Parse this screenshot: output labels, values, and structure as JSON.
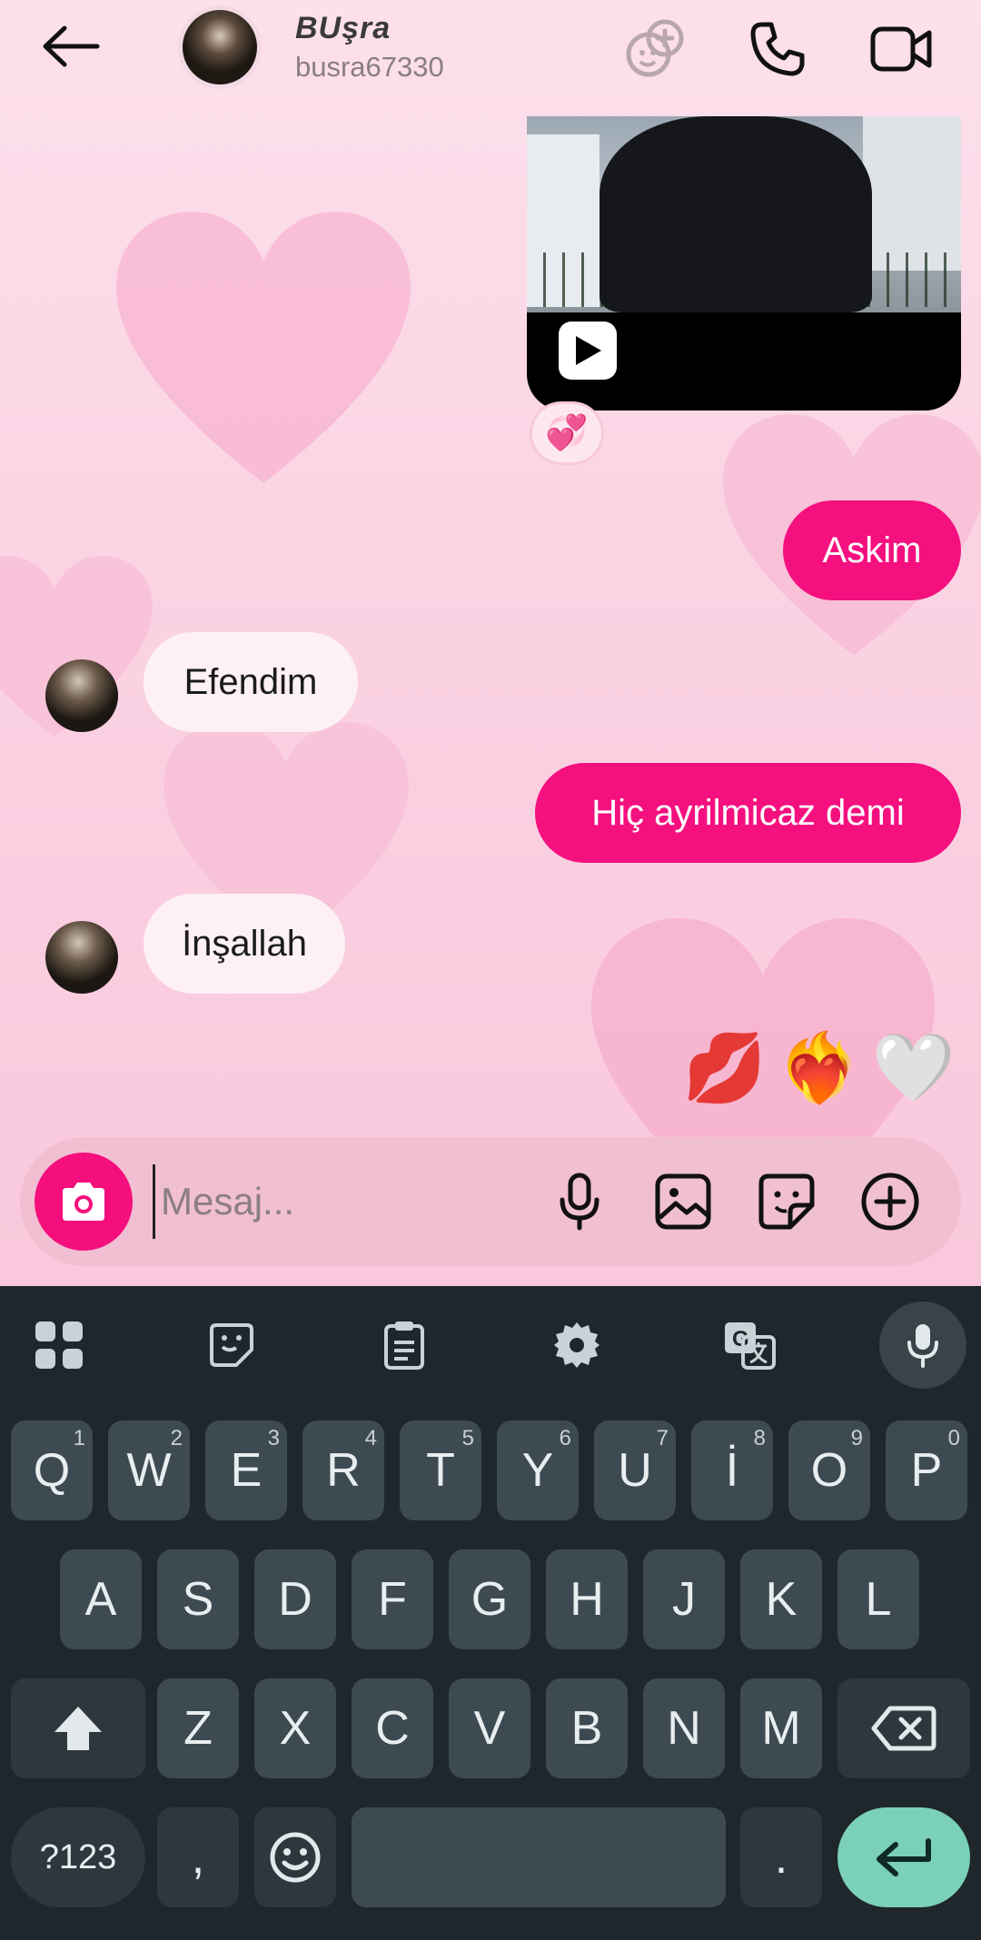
{
  "header": {
    "contact_name": "BUşra",
    "contact_handle": "busra67330"
  },
  "messages": [
    {
      "id": "askim",
      "direction": "sent",
      "text": "Askim"
    },
    {
      "id": "efendim",
      "direction": "received",
      "text": "Efendim"
    },
    {
      "id": "hic",
      "direction": "sent",
      "text": "Hiç ayrilmicaz demi"
    },
    {
      "id": "insallah",
      "direction": "received",
      "text": "İnşallah"
    }
  ],
  "video_reaction": "💞",
  "emoji_message": [
    "💋",
    "❤️‍🔥",
    "🤍"
  ],
  "composer": {
    "placeholder": "Mesaj..."
  },
  "keyboard": {
    "row1": [
      {
        "k": "Q",
        "h": "1"
      },
      {
        "k": "W",
        "h": "2"
      },
      {
        "k": "E",
        "h": "3"
      },
      {
        "k": "R",
        "h": "4"
      },
      {
        "k": "T",
        "h": "5"
      },
      {
        "k": "Y",
        "h": "6"
      },
      {
        "k": "U",
        "h": "7"
      },
      {
        "k": "İ",
        "h": "8"
      },
      {
        "k": "O",
        "h": "9"
      },
      {
        "k": "P",
        "h": "0"
      }
    ],
    "row2": [
      "A",
      "S",
      "D",
      "F",
      "G",
      "H",
      "J",
      "K",
      "L"
    ],
    "row3": [
      "Z",
      "X",
      "C",
      "V",
      "B",
      "N",
      "M"
    ],
    "symbols_label": "?123",
    "comma": ",",
    "period": "."
  },
  "colors": {
    "sent_bubble": "#f5107f",
    "received_bubble": "#fdf1f4",
    "keyboard_bg": "#1f272c",
    "enter_key": "#7bd1b7"
  }
}
